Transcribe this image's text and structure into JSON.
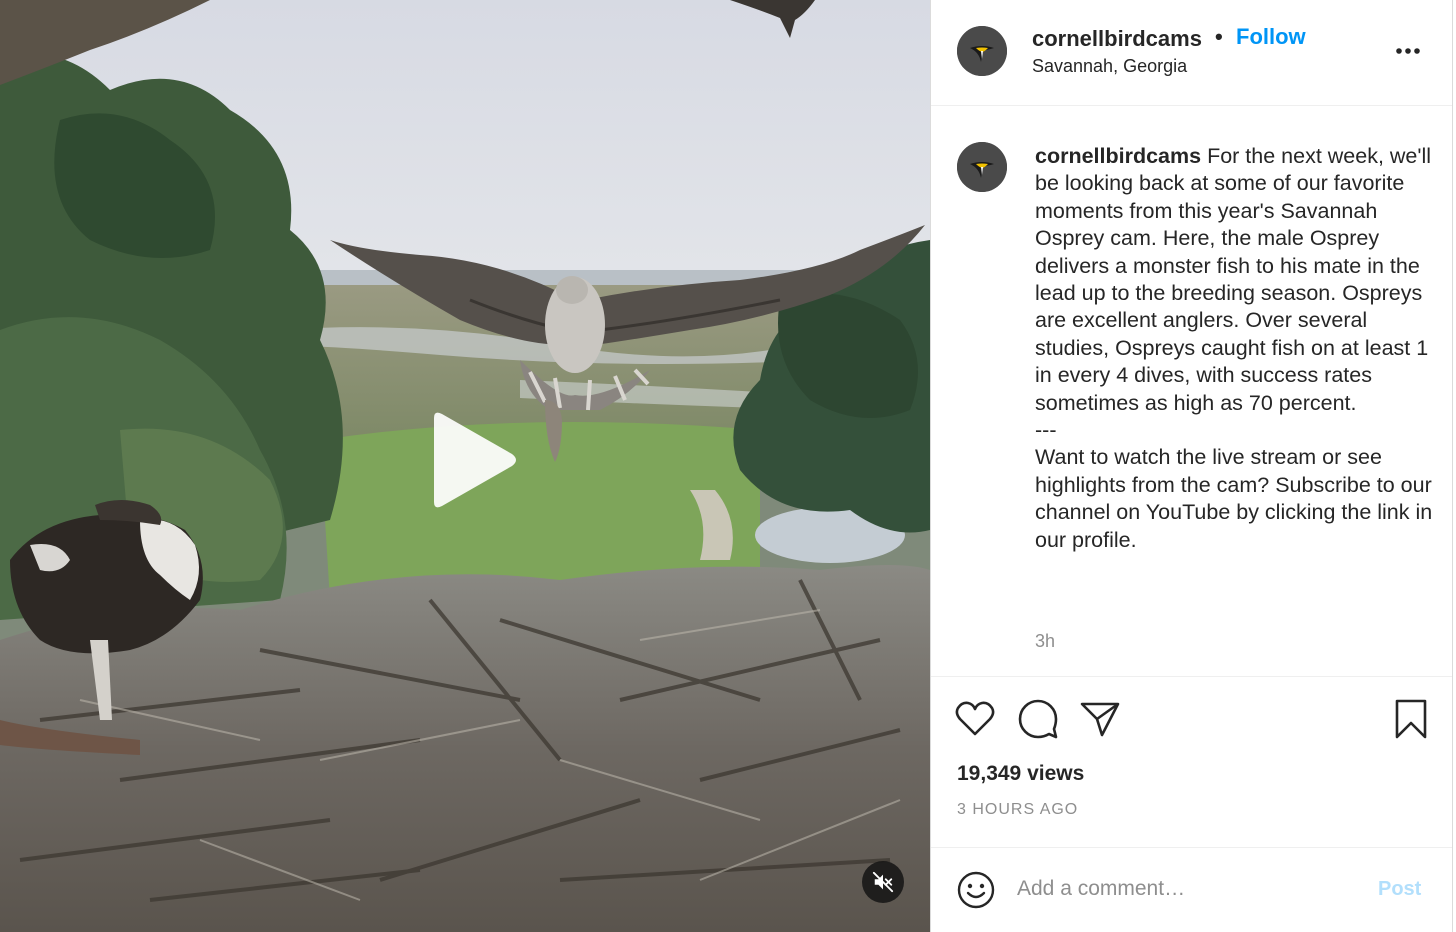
{
  "header": {
    "username": "cornellbirdcams",
    "separator": "•",
    "follow_label": "Follow",
    "location": "Savannah, Georgia",
    "more_icon": "more-horizontal-icon"
  },
  "caption": {
    "username": "cornellbirdcams",
    "text": " For the next week, we'll be looking back at some of our favorite moments from this year's Savannah Osprey cam. Here, the male Osprey delivers a monster fish to his mate in the lead up to the breeding season. Ospreys are excellent anglers. Over several studies, Ospreys caught fish on at least 1 in every 4 dives, with success rates sometimes as high as 70 percent.\n---\nWant to watch the live stream or see highlights from the cam? Subscribe to our channel on YouTube by clicking the link in our profile.",
    "time_ago": "3h"
  },
  "actions": {
    "like_icon": "heart-icon",
    "comment_icon": "comment-bubble-icon",
    "share_icon": "paper-plane-icon",
    "save_icon": "bookmark-icon"
  },
  "stats": {
    "views": "19,349 views",
    "posted": "3 HOURS AGO"
  },
  "comment": {
    "placeholder": "Add a comment…",
    "post_label": "Post"
  },
  "video": {
    "play_icon": "play-icon",
    "mute_icon": "muted-speaker-icon"
  },
  "colors": {
    "link_blue": "#0095f6",
    "post_disabled": "#b2dffc",
    "muted_text": "#8e8e8e",
    "border": "#dbdbdb"
  }
}
